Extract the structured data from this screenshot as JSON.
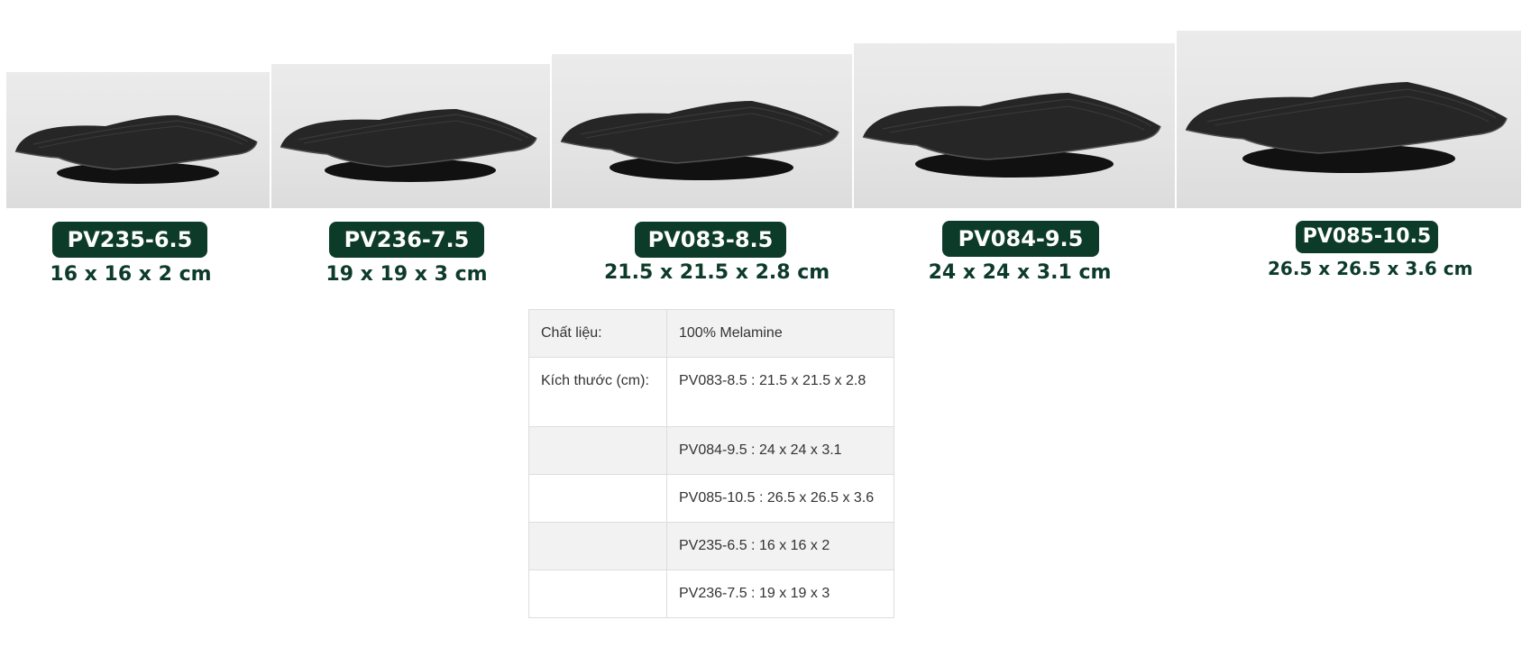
{
  "products": [
    {
      "code": "PV235-6.5",
      "dims": "16 x 16 x 2 cm"
    },
    {
      "code": "PV236-7.5",
      "dims": "19 x 19 x 3 cm"
    },
    {
      "code": "PV083-8.5",
      "dims": "21.5 x 21.5 x 2.8 cm"
    },
    {
      "code": "PV084-9.5",
      "dims": "24 x 24 x 3.1 cm"
    },
    {
      "code": "PV085-10.5",
      "dims": "26.5 x 26.5 x 3.6 cm"
    }
  ],
  "specs": {
    "rows": [
      {
        "label": "Chất liệu:",
        "value": "100% Melamine"
      },
      {
        "label": "Kích thước (cm):",
        "value": "PV083-8.5 : 21.5 x 21.5 x 2.8"
      },
      {
        "label": "",
        "value": "PV084-9.5 : 24 x 24 x 3.1"
      },
      {
        "label": "",
        "value": "PV085-10.5 : 26.5 x 26.5 x 3.6"
      },
      {
        "label": "",
        "value": "PV235-6.5 : 16 x 16 x 2"
      },
      {
        "label": "",
        "value": "PV236-7.5 : 19 x 19 x 3"
      }
    ]
  },
  "colors": {
    "badge_bg": "#0d3b2a",
    "badge_text": "#ffffff",
    "dims_text": "#0d3b2a",
    "plate": "#1f1f1f"
  },
  "icons": {
    "plate_photo": "black-square-plate-image"
  }
}
